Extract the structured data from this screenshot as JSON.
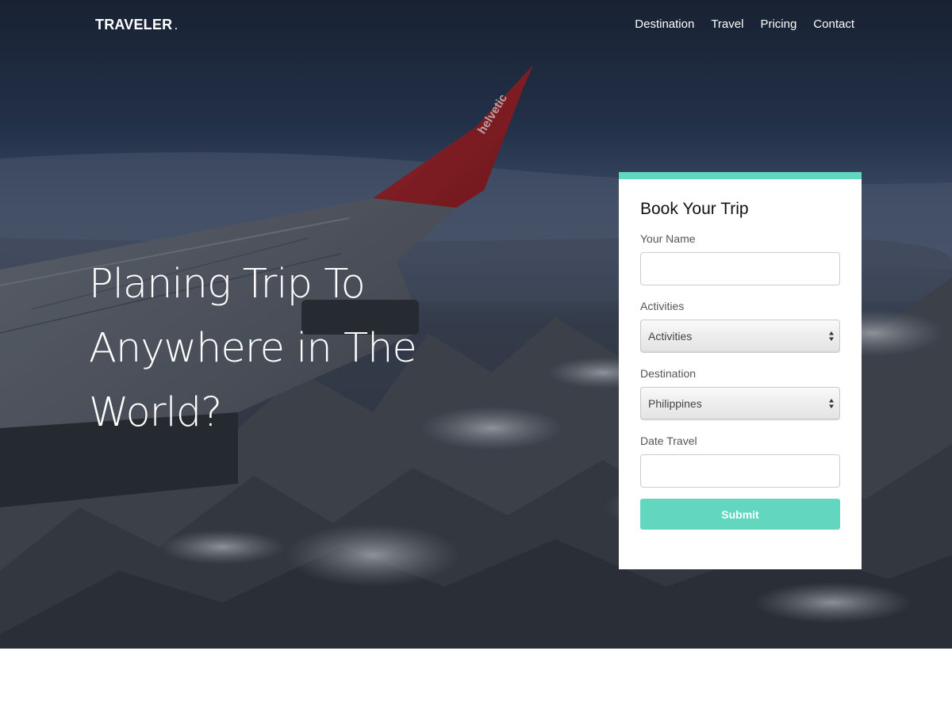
{
  "brand": {
    "name": "TRAVELER",
    "dot": "."
  },
  "nav": {
    "items": [
      {
        "label": "Destination"
      },
      {
        "label": "Travel"
      },
      {
        "label": "Pricing"
      },
      {
        "label": "Contact"
      }
    ]
  },
  "hero": {
    "headline_lines": [
      "Planing Trip To",
      "Anywhere in The",
      "World?"
    ],
    "image_text": "helvetic"
  },
  "booking": {
    "title": "Book Your Trip",
    "name_label": "Your Name",
    "name_value": "",
    "activities_label": "Activities",
    "activities_selected": "Activities",
    "destination_label": "Destination",
    "destination_selected": "Philippines",
    "date_label": "Date Travel",
    "date_value": "",
    "submit_label": "Submit"
  },
  "colors": {
    "accent": "#62d6bf",
    "card_background": "#ffffff",
    "nav_text": "#ffffff",
    "hero_overlay": "#2a3852",
    "wing_tip": "#c0282a"
  },
  "icons": {
    "select_arrows": "updown-arrows-icon"
  }
}
